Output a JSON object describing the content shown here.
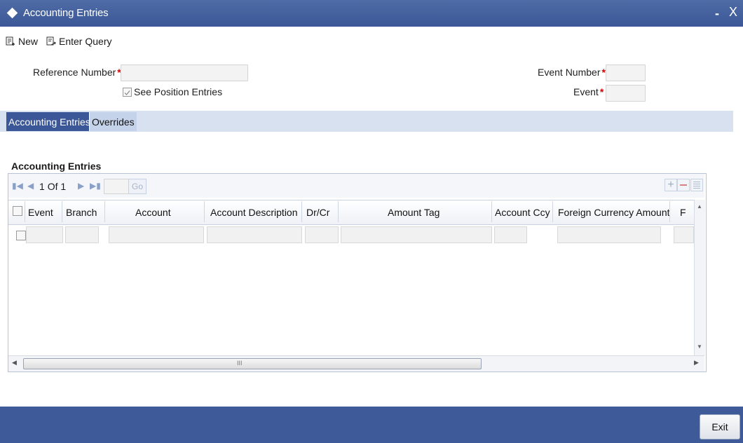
{
  "window": {
    "title": "Accounting Entries",
    "minimize": "-",
    "close": "X"
  },
  "toolbar": {
    "new_label": "New",
    "enter_query_label": "Enter Query"
  },
  "form": {
    "reference_number_label": "Reference Number",
    "reference_number_value": "",
    "event_number_label": "Event Number",
    "event_number_value": "",
    "event_label": "Event",
    "event_value": "",
    "required_mark": "*",
    "see_position_entries_label": "See Position Entries",
    "see_position_entries_checked": true
  },
  "tabs": [
    {
      "label": "Accounting Entries",
      "active": true
    },
    {
      "label": "Overrides",
      "active": false
    }
  ],
  "section_title": "Accounting Entries",
  "pager": {
    "current_page": "1",
    "of_label": "Of",
    "total_pages": "1",
    "go_label": "Go",
    "page_input": ""
  },
  "grid": {
    "columns": [
      "Event",
      "Branch",
      "Account",
      "Account Description",
      "Dr/Cr",
      "Amount Tag",
      "Account Ccy",
      "Foreign Currency Amount",
      "F"
    ],
    "rows": [
      {
        "selected": false,
        "cells": [
          "",
          "",
          "",
          "",
          "",
          "",
          "",
          "",
          ""
        ]
      }
    ],
    "hscroll_grip": "III"
  },
  "footer": {
    "exit_label": "Exit"
  },
  "colors": {
    "title_bar": "#3b5797",
    "active_tab": "#3b5797",
    "tab_strip": "#d8e1f0",
    "footer": "#3e5a98",
    "required": "#d40000"
  }
}
